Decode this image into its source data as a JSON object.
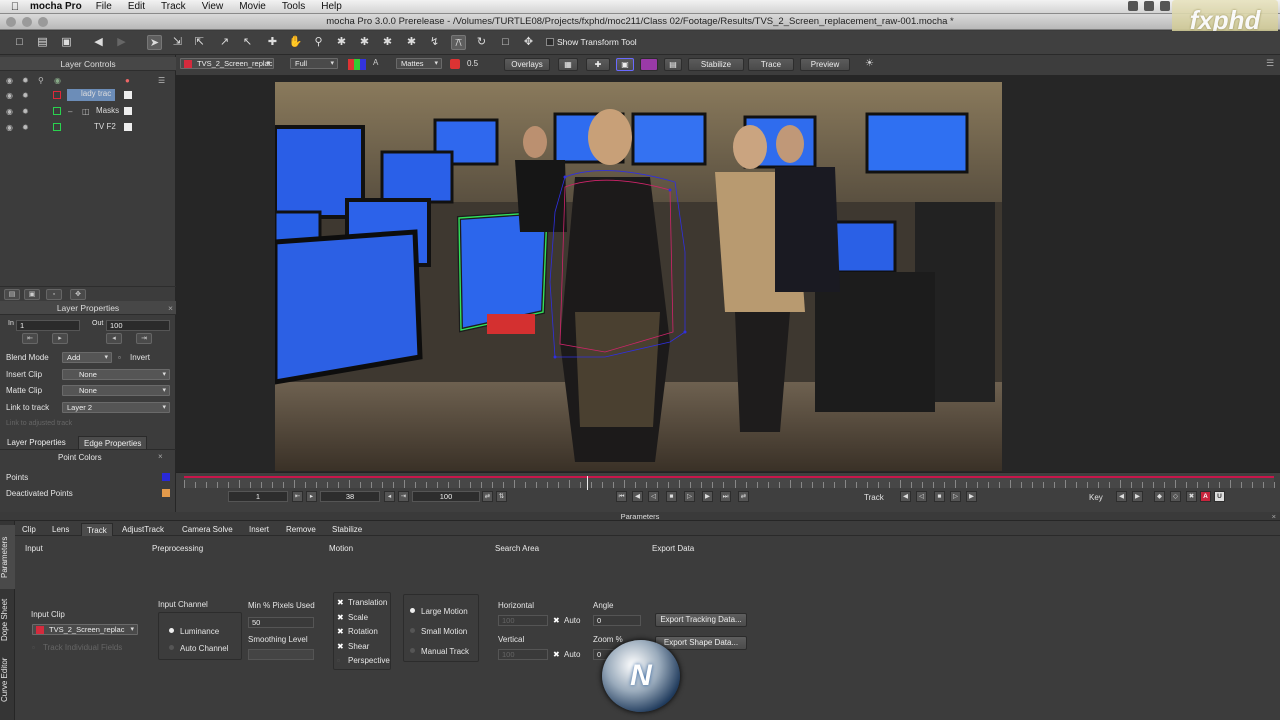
{
  "menubar": {
    "app_name": "mocha Pro",
    "items": [
      "File",
      "Edit",
      "Track",
      "View",
      "Movie",
      "Tools",
      "Help"
    ]
  },
  "window": {
    "title": "mocha Pro 3.0.0 Prerelease - /Volumes/TURTLE08/Projects/fxphd/moc211/Class 02/Footage/Results/TVS_2_Screen_replacement_raw-001.mocha *"
  },
  "watermark": "fxphd",
  "toolbar": {
    "show_transform_tool_label": "Show Transform Tool"
  },
  "viewer_bar": {
    "clip_name": "TVS_2_Screen_replac",
    "resolution": "Full",
    "mattes_label": "Mattes",
    "opacity_value": "0.5",
    "overlays_label": "Overlays",
    "stabilize_label": "Stabilize",
    "trace_label": "Trace",
    "preview_label": "Preview"
  },
  "layer_controls": {
    "title": "Layer Controls",
    "layers": [
      {
        "name": "lady trac",
        "color": "#e0283a"
      },
      {
        "name": "Masks",
        "color": "#2ad24e"
      },
      {
        "name": "TV F2",
        "color": "#2ad24e"
      }
    ]
  },
  "layer_properties": {
    "title": "Layer Properties",
    "in_label": "In",
    "in_value": "1",
    "out_label": "Out",
    "out_value": "100",
    "blend_mode_label": "Blend Mode",
    "blend_mode_value": "Add",
    "invert_label": "Invert",
    "insert_clip_label": "Insert Clip",
    "insert_clip_value": "None",
    "matte_clip_label": "Matte Clip",
    "matte_clip_value": "None",
    "link_to_track_label": "Link to track",
    "link_to_track_value": "Layer 2",
    "link_adjusted_label": "Link to adjusted track",
    "tab_layer_properties": "Layer Properties",
    "tab_edge_properties": "Edge Properties"
  },
  "point_colors": {
    "title": "Point Colors",
    "points_label": "Points",
    "points_color": "#2929d6",
    "deactivated_label": "Deactivated Points",
    "deactivated_color": "#e39a4b"
  },
  "timeline": {
    "start_frame": "1",
    "current_frame": "38",
    "end_frame": "100",
    "track_label": "Track",
    "key_label": "Key",
    "playhead_fraction": 0.37
  },
  "parameters": {
    "header": "Parameters",
    "tabs": [
      "Clip",
      "Lens",
      "Track",
      "AdjustTrack",
      "Camera Solve",
      "Insert",
      "Remove",
      "Stabilize"
    ],
    "active_tab": "Track",
    "side_tabs": [
      "Parameters",
      "Dope Sheet",
      "Curve Editor"
    ],
    "sections": {
      "input": "Input",
      "preprocessing": "Preprocessing",
      "motion": "Motion",
      "search_area": "Search Area",
      "export_data": "Export Data"
    },
    "input_clip_label": "Input Clip",
    "input_clip_value": "TVS_2_Screen_replac",
    "track_individual_fields": "Track Individual Fields",
    "input_channel_label": "Input Channel",
    "luminance_label": "Luminance",
    "auto_channel_label": "Auto Channel",
    "min_pixels_label": "Min % Pixels Used",
    "min_pixels_value": "50",
    "smoothing_label": "Smoothing Level",
    "motion_options": [
      "Translation",
      "Scale",
      "Rotation",
      "Shear",
      "Perspective"
    ],
    "motion_checked": [
      true,
      true,
      true,
      true,
      false
    ],
    "motion_modes": [
      "Large Motion",
      "Small Motion",
      "Manual Track"
    ],
    "horizontal_label": "Horizontal",
    "vertical_label": "Vertical",
    "horizontal_value": "100",
    "vertical_value": "100",
    "auto_label": "Auto",
    "angle_label": "Angle",
    "angle_value": "0",
    "zoom_label": "Zoom %",
    "zoom_value": "0",
    "export_tracking_button": "Export Tracking Data...",
    "export_shape_button": "Export Shape Data..."
  }
}
